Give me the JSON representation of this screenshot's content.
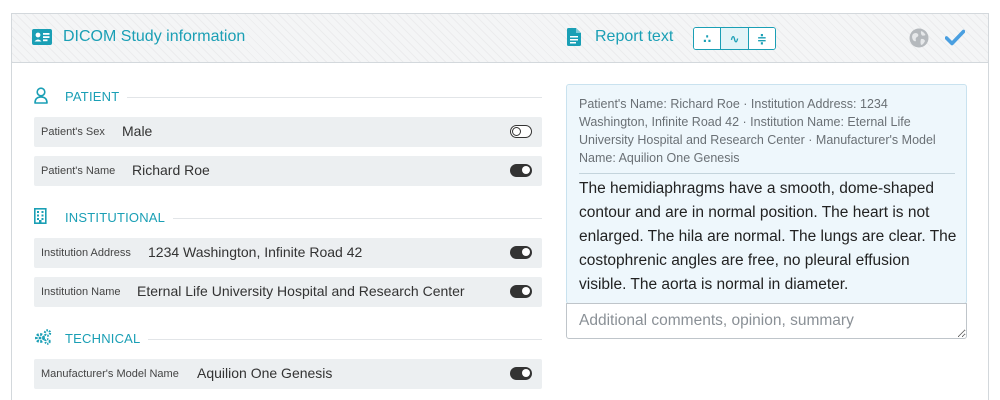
{
  "header": {
    "study_title": "DICOM Study information",
    "report_title": "Report text",
    "modes": [
      "∴",
      "∿",
      "≑"
    ],
    "active_mode": 1
  },
  "colors": {
    "accent": "#1a9fb5",
    "check": "#4a9fe0",
    "globe": "#b5b9bd"
  },
  "sections": {
    "patient": {
      "title": "PATIENT",
      "fields": [
        {
          "label": "Patient's Sex",
          "value": "Male",
          "enabled": false
        },
        {
          "label": "Patient's Name",
          "value": "Richard Roe",
          "enabled": true
        }
      ]
    },
    "institutional": {
      "title": "INSTITUTIONAL",
      "fields": [
        {
          "label": "Institution Address",
          "value": "1234 Washington, Infinite Road 42",
          "enabled": true
        },
        {
          "label": "Institution Name",
          "value": "Eternal Life University Hospital and Research Center",
          "enabled": true
        }
      ]
    },
    "technical": {
      "title": "TECHNICAL",
      "fields": [
        {
          "label": "Manufacturer's Model Name",
          "value": "Aquilion One Genesis",
          "enabled": true
        }
      ]
    }
  },
  "report": {
    "meta": "Patient's Name: Richard Roe · Institution Address: 1234 Washington, Infinite Road 42 · Institution Name: Eternal Life University Hospital and Research Center · Manufacturer's Model Name: Aquilion One Genesis",
    "body": "The hemidiaphragms have a smooth, dome-shaped contour and are in normal position. The heart is not enlarged. The hila are normal. The lungs are clear. The costophrenic angles are free, no pleural effusion visible. The aorta is normal in diameter.",
    "comments_placeholder": "Additional comments, opinion, summary",
    "comments_value": ""
  }
}
